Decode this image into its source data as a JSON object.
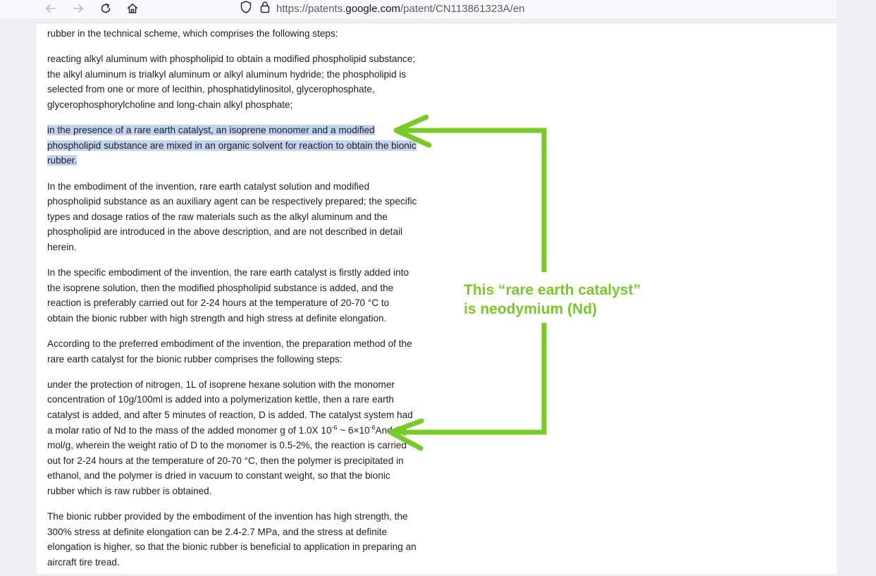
{
  "browser": {
    "url_prefix": "https://patents.",
    "url_domain": "google.com",
    "url_suffix": "/patent/CN113861323A/en"
  },
  "document": {
    "p1": "rubber in the technical scheme, which comprises the following steps:",
    "p2": "reacting alkyl aluminum with phospholipid to obtain a modified phospholipid substance; the alkyl aluminum is trialkyl aluminum or alkyl aluminum hydride; the phospholipid is selected from one or more of lecithin, phosphatidylinositol, glycerophosphate, glycerophosphorylcholine and long-chain alkyl phosphate;",
    "p3": "in the presence of a rare earth catalyst, an isoprene monomer and a modified phospholipid substance are mixed in an organic solvent for reaction to obtain the bionic rubber.",
    "p4": "In the embodiment of the invention, rare earth catalyst solution and modified phospholipid substance as an auxiliary agent can be respectively prepared; the specific types and dosage ratios of the raw materials such as the alkyl aluminum and the phospholipid are introduced in the above description, and are not described in detail herein.",
    "p5": "In the specific embodiment of the invention, the rare earth catalyst is firstly added into the isoprene solution, then the modified phospholipid substance is added, and the reaction is preferably carried out for 2-24 hours at the temperature of 20-70 °C to obtain the bionic rubber with high strength and high stress at definite elongation.",
    "p6": "According to the preferred embodiment of the invention, the preparation method of the rare earth catalyst for the bionic rubber comprises the following steps:",
    "p7a": "under the protection of nitrogen, 1L of isoprene hexane solution with the monomer concentration of 10g/100ml is added into a polymerization kettle, then a rare earth catalyst is added, and after 5 minutes of reaction, D is added. The catalyst system had a molar ratio of Nd to the mass of the added monomer g of 1.0X 10",
    "p7_sup1": "-6",
    "p7b": " ~ 6×10",
    "p7_sup2": "-6",
    "p7c": "And (3) mol/g, wherein the weight ratio of D to the monomer is 0.5-2%, the reaction is carried out for 2-24 hours at the temperature of 20-70 °C, then the polymer is precipitated in ethanol, and the polymer is dried in vacuum to constant weight, so that the bionic rubber which is raw rubber is obtained.",
    "p8": "The bionic rubber provided by the embodiment of the invention has high strength, the 300% stress at definite elongation can be 2.4-2.7 MPa, and the stress at definite elongation is higher, so that the bionic rubber is beneficial to application in preparing an aircraft tire tread."
  },
  "annotation": {
    "line1": "This “rare earth catalyst”",
    "line2": "is neodymium (Nd)",
    "color": "#76cc25"
  },
  "icons": [
    "back-icon",
    "forward-icon",
    "reload-icon",
    "home-icon",
    "shield-icon",
    "lock-icon"
  ]
}
